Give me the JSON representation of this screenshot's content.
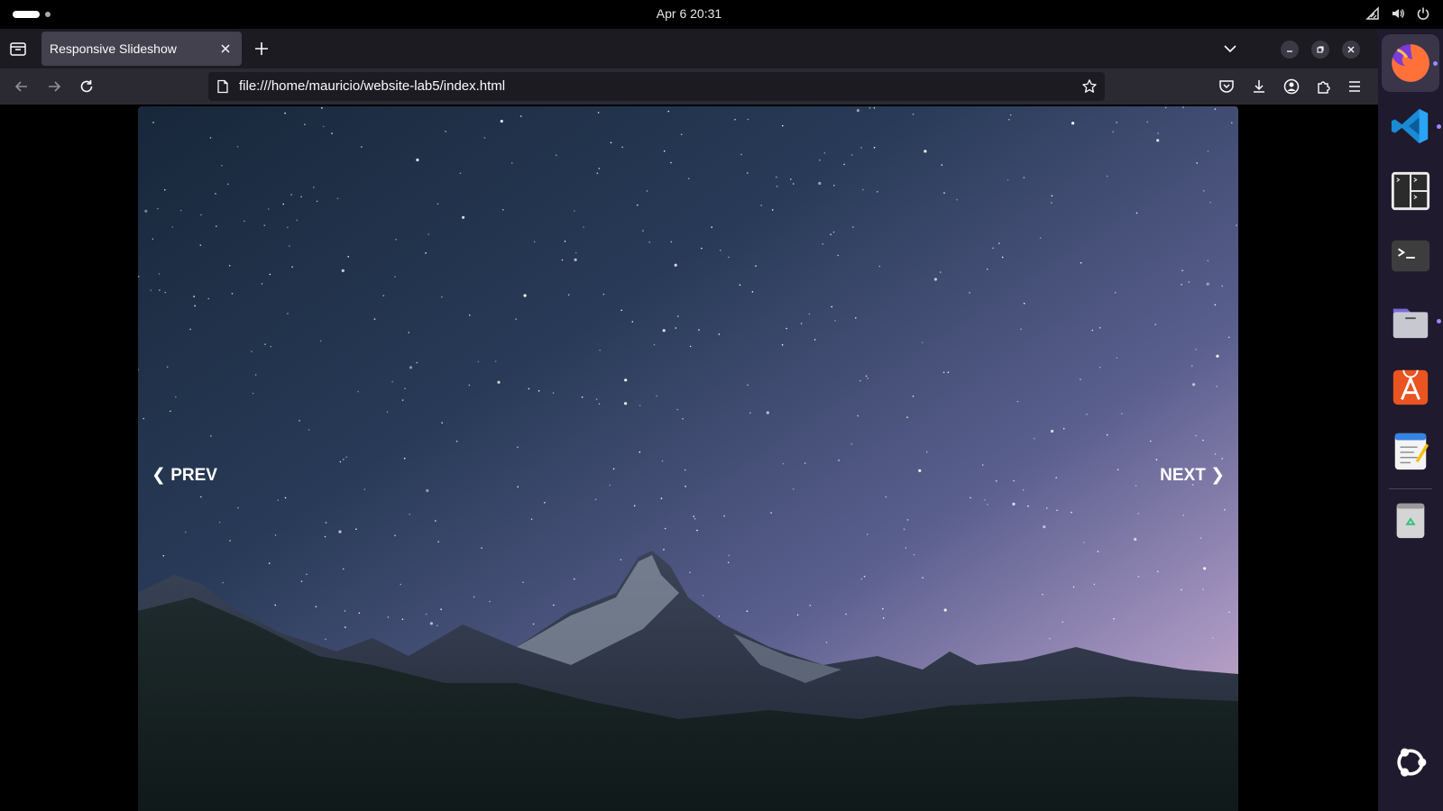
{
  "system": {
    "clock": "Apr 6  20:31"
  },
  "browser": {
    "tab_title": "Responsive Slideshow",
    "url": "file:///home/mauricio/website-lab5/index.html"
  },
  "slideshow": {
    "prev_label": "❮ PREV",
    "next_label": "NEXT ❯"
  },
  "dock": {
    "apps": [
      {
        "name": "Firefox",
        "icon": "firefox-icon"
      },
      {
        "name": "Visual Studio Code",
        "icon": "vscode-icon"
      },
      {
        "name": "Terminator",
        "icon": "terminator-icon"
      },
      {
        "name": "Terminal",
        "icon": "terminal-icon"
      },
      {
        "name": "Files",
        "icon": "files-icon"
      },
      {
        "name": "App Center",
        "icon": "app-center-icon"
      },
      {
        "name": "Text Editor",
        "icon": "text-editor-icon"
      },
      {
        "name": "Trash",
        "icon": "trash-icon"
      },
      {
        "name": "Show Apps",
        "icon": "ubuntu-logo-icon"
      }
    ]
  }
}
